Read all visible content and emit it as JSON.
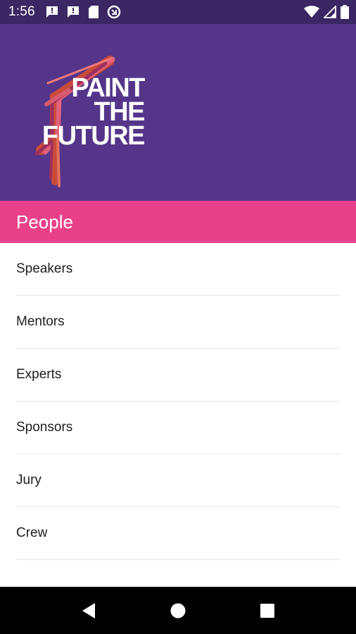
{
  "status_bar": {
    "time": "1:56",
    "left_icons": [
      "message-alert-icon",
      "message-alert-icon",
      "sd-card-icon",
      "data-saver-icon"
    ],
    "right_icons": [
      "wifi-icon",
      "signal-icon",
      "battery-icon"
    ]
  },
  "hero": {
    "logo_lines": [
      "PAINT",
      "THE",
      "FUTURE"
    ],
    "background_color": "#55358a"
  },
  "section": {
    "title": "People",
    "color": "#e8418a"
  },
  "list": {
    "items": [
      {
        "label": "Speakers"
      },
      {
        "label": "Mentors"
      },
      {
        "label": "Experts"
      },
      {
        "label": "Sponsors"
      },
      {
        "label": "Jury"
      },
      {
        "label": "Crew"
      }
    ]
  },
  "nav_bar": {
    "buttons": [
      "back-icon",
      "home-icon",
      "recents-icon"
    ]
  }
}
